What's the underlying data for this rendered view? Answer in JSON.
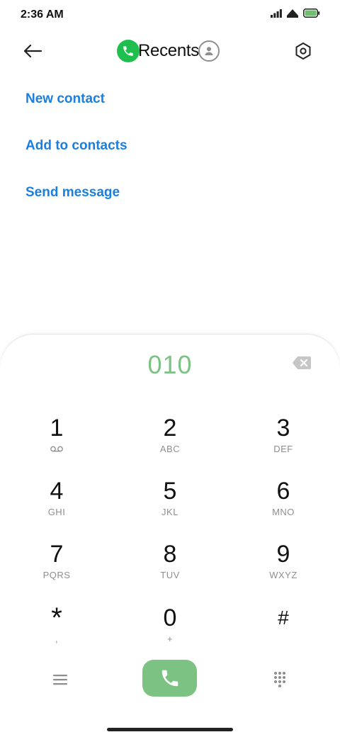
{
  "status_bar": {
    "time": "2:36 AM"
  },
  "header": {
    "title": "Recents",
    "icons": {
      "back": "arrow-left-icon",
      "phone": "phone-icon",
      "contact": "person-icon",
      "settings": "gear-icon"
    }
  },
  "actions": [
    {
      "label": "New contact"
    },
    {
      "label": "Add to contacts"
    },
    {
      "label": "Send message"
    }
  ],
  "dialpad": {
    "number": "010",
    "keys": [
      {
        "digit": "1",
        "sub": "",
        "sub_icon": "voicemail-icon"
      },
      {
        "digit": "2",
        "sub": "ABC"
      },
      {
        "digit": "3",
        "sub": "DEF"
      },
      {
        "digit": "4",
        "sub": "GHI"
      },
      {
        "digit": "5",
        "sub": "JKL"
      },
      {
        "digit": "6",
        "sub": "MNO"
      },
      {
        "digit": "7",
        "sub": "PQRS"
      },
      {
        "digit": "8",
        "sub": "TUV"
      },
      {
        "digit": "9",
        "sub": "WXYZ"
      },
      {
        "digit": "*",
        "sub": ","
      },
      {
        "digit": "0",
        "sub": "+"
      },
      {
        "digit": "#",
        "sub": ""
      }
    ]
  },
  "colors": {
    "accent_blue": "#1a7fe0",
    "call_green": "#7cc283",
    "badge_green": "#1fbf4f",
    "sub_gray": "#8e8e8e"
  }
}
